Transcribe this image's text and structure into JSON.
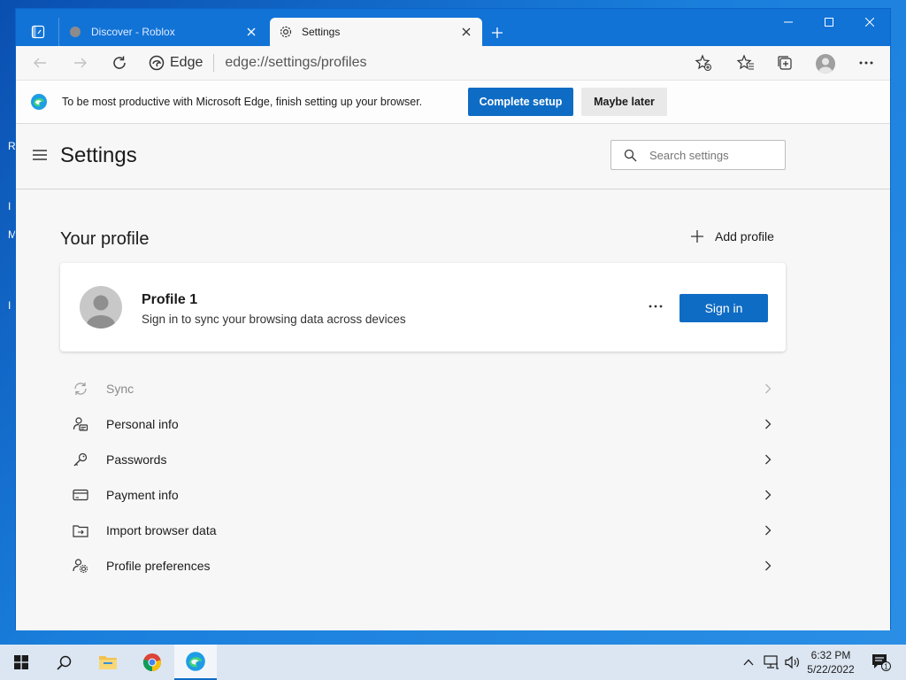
{
  "desktop": {
    "edge_letters": [
      "R",
      "I",
      "M",
      "I"
    ]
  },
  "window": {
    "tabs": [
      {
        "title": "Discover - Roblox",
        "state": "inactive"
      },
      {
        "title": "Settings",
        "state": "active"
      }
    ]
  },
  "toolbar": {
    "address_brand": "Edge",
    "address_url": "edge://settings/profiles"
  },
  "infobar": {
    "message": "To be most productive with Microsoft Edge, finish setting up your browser.",
    "primary_label": "Complete setup",
    "secondary_label": "Maybe later"
  },
  "settings": {
    "title": "Settings",
    "search_placeholder": "Search settings"
  },
  "profile_section": {
    "title": "Your profile",
    "add_profile_label": "Add profile",
    "profile_name": "Profile 1",
    "profile_sub": "Sign in to sync your browsing data across devices",
    "sign_in_label": "Sign in"
  },
  "menu": [
    {
      "label": "Sync",
      "icon": "sync-icon",
      "disabled": true
    },
    {
      "label": "Personal info",
      "icon": "personal-info-icon",
      "disabled": false
    },
    {
      "label": "Passwords",
      "icon": "key-icon",
      "disabled": false
    },
    {
      "label": "Payment info",
      "icon": "card-icon",
      "disabled": false
    },
    {
      "label": "Import browser data",
      "icon": "import-icon",
      "disabled": false
    },
    {
      "label": "Profile preferences",
      "icon": "profile-preferences-icon",
      "disabled": false
    }
  ],
  "taskbar": {
    "time": "6:32 PM",
    "date": "5/22/2022",
    "notification_count": "1"
  },
  "colors": {
    "accent": "#0f6cc4",
    "titlebar": "#1173d6",
    "desktop": "#1a7fdc"
  }
}
